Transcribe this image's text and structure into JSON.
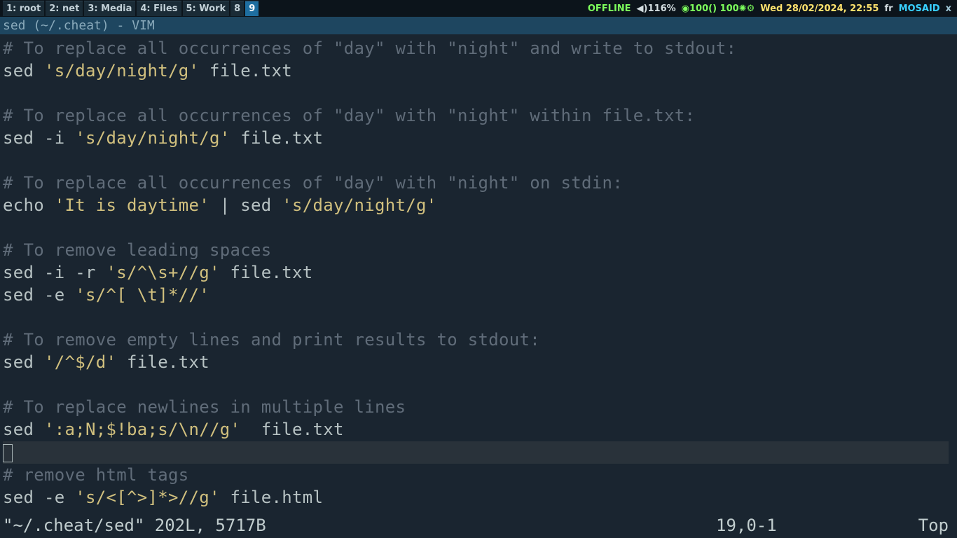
{
  "topbar": {
    "workspaces": [
      "1: root",
      "2: net",
      "3: Media",
      "4: Files",
      "5: Work",
      "8",
      "9"
    ],
    "active_ws_index": 6,
    "offline": "OFFLINE",
    "volume_icon": "◀)",
    "volume": "116%",
    "battery_icon": "◉",
    "battery": "100() 100✺⚙",
    "datetime": "Wed 28/02/2024, 22:55",
    "kbd": "fr",
    "user": "MOSAID",
    "close": "x"
  },
  "title": "sed (~/.cheat) - VIM",
  "lines": {
    "c1": "# To replace all occurrences of \"day\" with \"night\" and write to stdout:",
    "l1a": "sed ",
    "l1b": "'s/day/night/g'",
    "l1c": " file.txt",
    "c2": "# To replace all occurrences of \"day\" with \"night\" within file.txt:",
    "l2a": "sed -i ",
    "l2b": "'s/day/night/g'",
    "l2c": " file.txt",
    "c3": "# To replace all occurrences of \"day\" with \"night\" on stdin:",
    "l3a": "echo ",
    "l3b": "'It is daytime'",
    "l3c": " | sed ",
    "l3d": "'s/day/night/g'",
    "c4": "# To remove leading spaces",
    "l4a": "sed -i -r ",
    "l4b": "'s/^\\s+//g'",
    "l4c": " file.txt",
    "l5a": "sed -e ",
    "l5b": "'s/^[ \\t]*//'",
    "c6": "# To remove empty lines and print results to stdout:",
    "l6a": "sed ",
    "l6b": "'/^$/d'",
    "l6c": " file.txt",
    "c7": "# To replace newlines in multiple lines",
    "l7a": "sed ",
    "l7b": "':a;N;$!ba;s/\\n//g'",
    "l7c": "  file.txt",
    "c8": "# remove html tags",
    "l8a": "sed -e ",
    "l8b": "'s/<[^>]*>//g'",
    "l8c": " file.html"
  },
  "vimstatus": {
    "left": "\"~/.cheat/sed\" 202L, 5717B",
    "mid": "19,0-1",
    "right": "Top"
  }
}
